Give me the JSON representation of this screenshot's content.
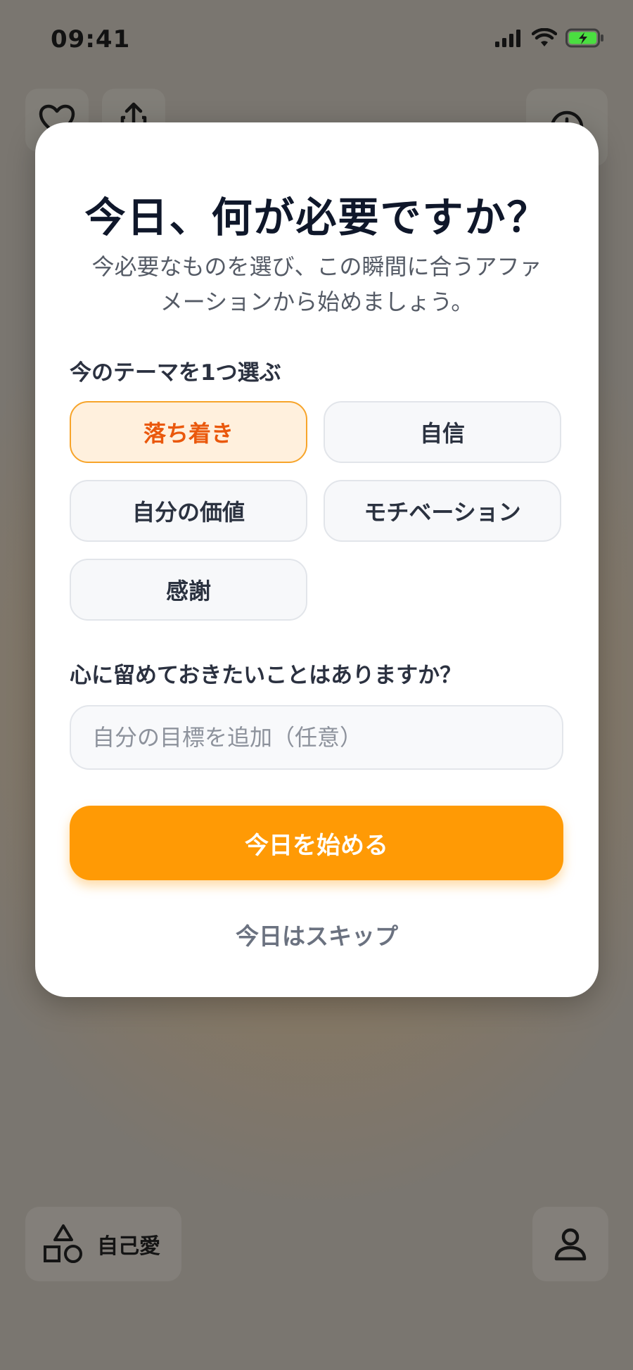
{
  "status_bar": {
    "time": "09:41",
    "icons": [
      "signal-icon",
      "wifi-icon",
      "battery-charging-icon"
    ]
  },
  "background": {
    "top_left_icons": [
      "heart-icon",
      "share-icon"
    ],
    "top_right_icon": "clock-icon",
    "bottom_nav": {
      "category_label": "自己愛",
      "category_icon": "shapes-icon",
      "profile_icon": "person-icon"
    }
  },
  "modal": {
    "title": "今日、何が必要ですか？",
    "subtitle_line1": "今必要なものを選び、この瞬間に合うアファ",
    "subtitle_line2": "メーションから始めましょう。",
    "theme_label": "今のテーマを1つ選ぶ",
    "themes": [
      {
        "label": "落ち着き",
        "selected": true
      },
      {
        "label": "自信",
        "selected": false
      },
      {
        "label": "自分の価値",
        "selected": false
      },
      {
        "label": "モチベーション",
        "selected": false
      },
      {
        "label": "感謝",
        "selected": false
      }
    ],
    "note_label": "心に留めておきたいことはありますか？",
    "goal_input": {
      "placeholder": "自分の目標を追加（任意）",
      "value": ""
    },
    "start_button": "今日を始める",
    "skip_link": "今日はスキップ"
  },
  "colors": {
    "accent": "#ff9a05",
    "selected_chip_bg": "#fff0dd",
    "selected_chip_border": "#f7a42a",
    "selected_chip_text": "#ea580c",
    "title": "#0f172a"
  }
}
